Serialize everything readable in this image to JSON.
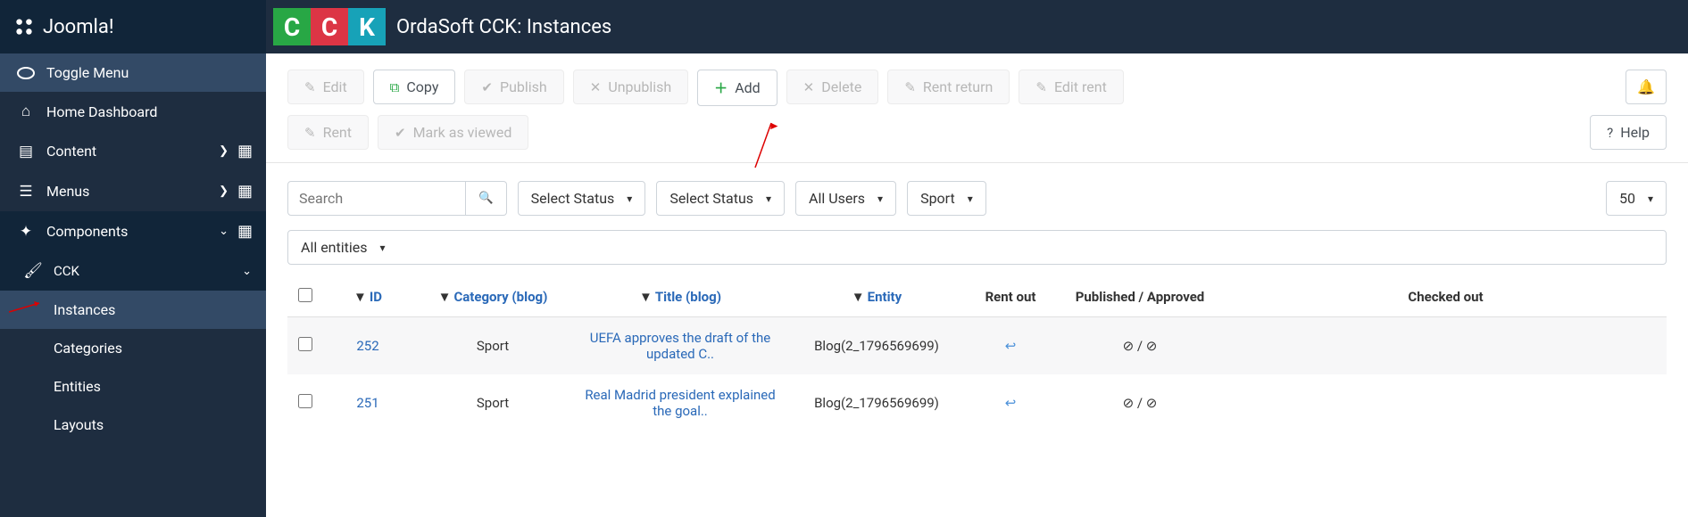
{
  "brand": "Joomla!",
  "page_title": "OrdaSoft CCK: Instances",
  "sidebar": {
    "toggle": "Toggle Menu",
    "items": [
      {
        "icon": "home",
        "label": "Home Dashboard"
      },
      {
        "icon": "content",
        "label": "Content",
        "chev": true,
        "dots": true
      },
      {
        "icon": "menus",
        "label": "Menus",
        "chev": true,
        "dots": true
      },
      {
        "icon": "components",
        "label": "Components",
        "chev_down": true,
        "dots": true
      }
    ],
    "cck_label": "CCK",
    "sub": [
      {
        "label": "Instances",
        "active": true
      },
      {
        "label": "Categories"
      },
      {
        "label": "Entities"
      },
      {
        "label": "Layouts"
      }
    ]
  },
  "toolbar": {
    "edit": "Edit",
    "copy": "Copy",
    "publish": "Publish",
    "unpublish": "Unpublish",
    "add": "Add",
    "delete": "Delete",
    "rent_return": "Rent return",
    "edit_rent": "Edit rent",
    "rent": "Rent",
    "mark_viewed": "Mark as viewed",
    "help": "Help"
  },
  "filters": {
    "search_placeholder": "Search",
    "status1": "Select Status",
    "status2": "Select Status",
    "users": "All Users",
    "sport": "Sport",
    "perpage": "50",
    "entities": "All entities"
  },
  "columns": {
    "id": "ID",
    "category": "Category (blog)",
    "title": "Title (blog)",
    "entity": "Entity",
    "rentout": "Rent out",
    "pubapp": "Published / Approved",
    "checked": "Checked out"
  },
  "rows": [
    {
      "id": "252",
      "category": "Sport",
      "title": "UEFA approves the draft of the updated C..",
      "entity": "Blog(2_1796569699)",
      "pubapp": "⊘ / ⊘"
    },
    {
      "id": "251",
      "category": "Sport",
      "title": "Real Madrid president explained the goal..",
      "entity": "Blog(2_1796569699)",
      "pubapp": "⊘ / ⊘"
    }
  ]
}
